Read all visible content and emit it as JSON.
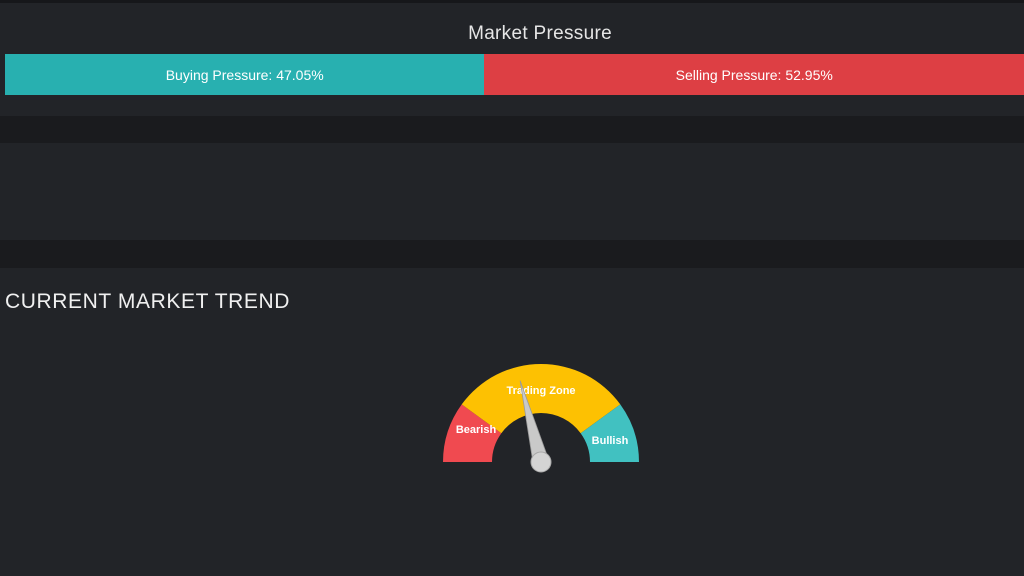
{
  "market_pressure": {
    "title": "Market Pressure",
    "buying": {
      "label": "Buying Pressure: 47.05%",
      "percent": 47.05,
      "color": "#28b0b0"
    },
    "selling": {
      "label": "Selling Pressure: 52.95%",
      "percent": 52.95,
      "color": "#dd3f44"
    }
  },
  "market_trend": {
    "title": "CURRENT MARKET TREND",
    "gauge": {
      "bands": [
        {
          "label": "Bearish",
          "from": 0,
          "to": 20,
          "color": "#f04a50"
        },
        {
          "label": "Trading Zone",
          "from": 20,
          "to": 80,
          "color": "#fdc102"
        },
        {
          "label": "Bullish",
          "from": 80,
          "to": 100,
          "color": "#41c1c1"
        }
      ],
      "needle_value": 42,
      "needle_color": "#c9c9c9"
    }
  }
}
